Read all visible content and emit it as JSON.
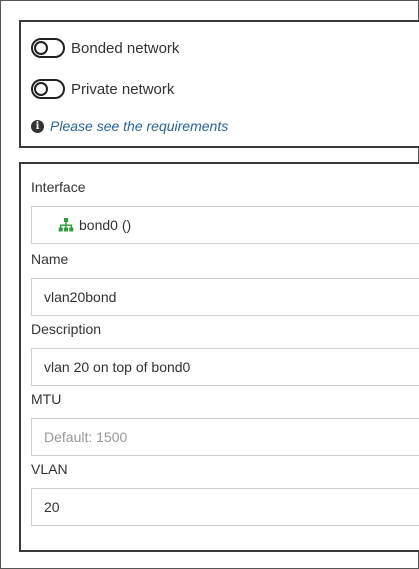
{
  "network_options": {
    "bonded_label": "Bonded network",
    "private_label": "Private network",
    "requirements_link": "Please see the requirements",
    "bonded_enabled": false,
    "private_enabled": false
  },
  "form": {
    "interface": {
      "label": "Interface",
      "value": "bond0 ()"
    },
    "name": {
      "label": "Name",
      "value": "vlan20bond"
    },
    "description": {
      "label": "Description",
      "value": "vlan 20 on top of bond0"
    },
    "mtu": {
      "label": "MTU",
      "placeholder": "Default: 1500",
      "value": ""
    },
    "vlan": {
      "label": "VLAN",
      "value": "20"
    }
  },
  "icons": {
    "info": "info-circle-icon",
    "interface": "sitemap-icon"
  },
  "colors": {
    "link": "#2a6496",
    "interface_icon": "#2e9e3a"
  }
}
